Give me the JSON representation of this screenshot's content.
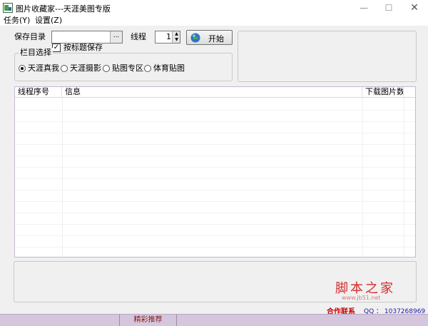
{
  "window": {
    "title": "图片收藏家---天涯美图专版",
    "icon": "app-icon",
    "controls": {
      "minimize": "—",
      "maximize": "☐",
      "close": "✕"
    }
  },
  "menu": {
    "items": [
      {
        "label": "任务(Y)"
      },
      {
        "label": "设置(Z)"
      }
    ]
  },
  "toolbar": {
    "save_dir_label": "保存目录",
    "save_dir_value": "",
    "browse_label": "...",
    "threads_label": "线程",
    "threads_value": "1",
    "start_label": "开始"
  },
  "options": {
    "save_by_title_label": "按标题保存",
    "save_by_title_checked": true,
    "check_mark": "✓"
  },
  "category": {
    "group_title": "栏目选择",
    "items": [
      {
        "label": "天涯真我",
        "selected": true
      },
      {
        "label": "天涯摄影",
        "selected": false
      },
      {
        "label": "贴图专区",
        "selected": false
      },
      {
        "label": "体育贴图",
        "selected": false
      }
    ]
  },
  "table": {
    "columns": [
      "线程序号",
      "信息",
      "下载图片数"
    ],
    "rows": []
  },
  "footer": {
    "watermark_cn": "脚本之家",
    "watermark_url": "www.jb51.net",
    "partner_label": "合作联系",
    "qq_text": "QQ ：  1037268969",
    "status_featured": "精彩推荐"
  }
}
